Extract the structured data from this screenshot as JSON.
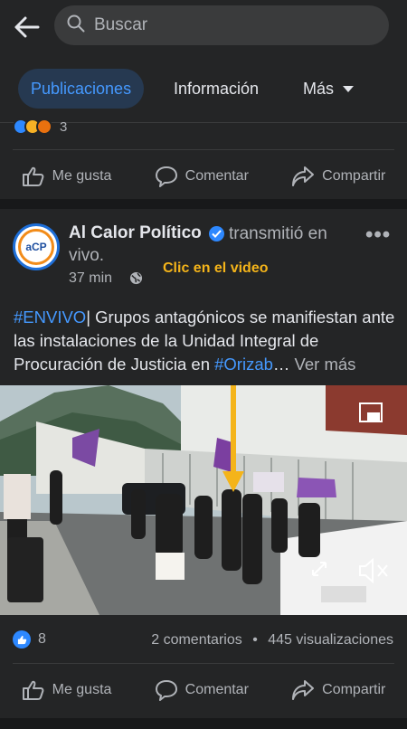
{
  "search": {
    "placeholder": "Buscar"
  },
  "tabs": [
    {
      "label": "Publicaciones",
      "active": true
    },
    {
      "label": "Información"
    },
    {
      "label": "Más"
    }
  ],
  "post1": {
    "reaction_count": "3",
    "actions": {
      "like": "Me gusta",
      "comment": "Comentar",
      "share": "Compartir"
    }
  },
  "post2": {
    "page_name": "Al Calor Político",
    "live_text_1": "transmitió en",
    "live_text_2": "vivo.",
    "time": "37 min",
    "avatar_text": "aCP",
    "text_hashtag": "#ENVIVO",
    "text_body_1": "| Grupos antagónicos se manifiestan ante las instalaciones de la Unidad Integral de Procuración de Justicia en ",
    "text_hashtag_2": "#Orizab",
    "text_ellipsis": "… ",
    "more_label": "Ver más",
    "video_label": "Clic en el video",
    "reaction_count": "8",
    "comments": "2 comentarios",
    "separator": "•",
    "views": "445 visualizaciones",
    "actions": {
      "like": "Me gusta",
      "comment": "Comentar",
      "share": "Compartir"
    }
  },
  "colors": {
    "background": "#18191a",
    "surface": "#242526",
    "accent": "#2d88ff",
    "annotation": "#f4b41a"
  }
}
